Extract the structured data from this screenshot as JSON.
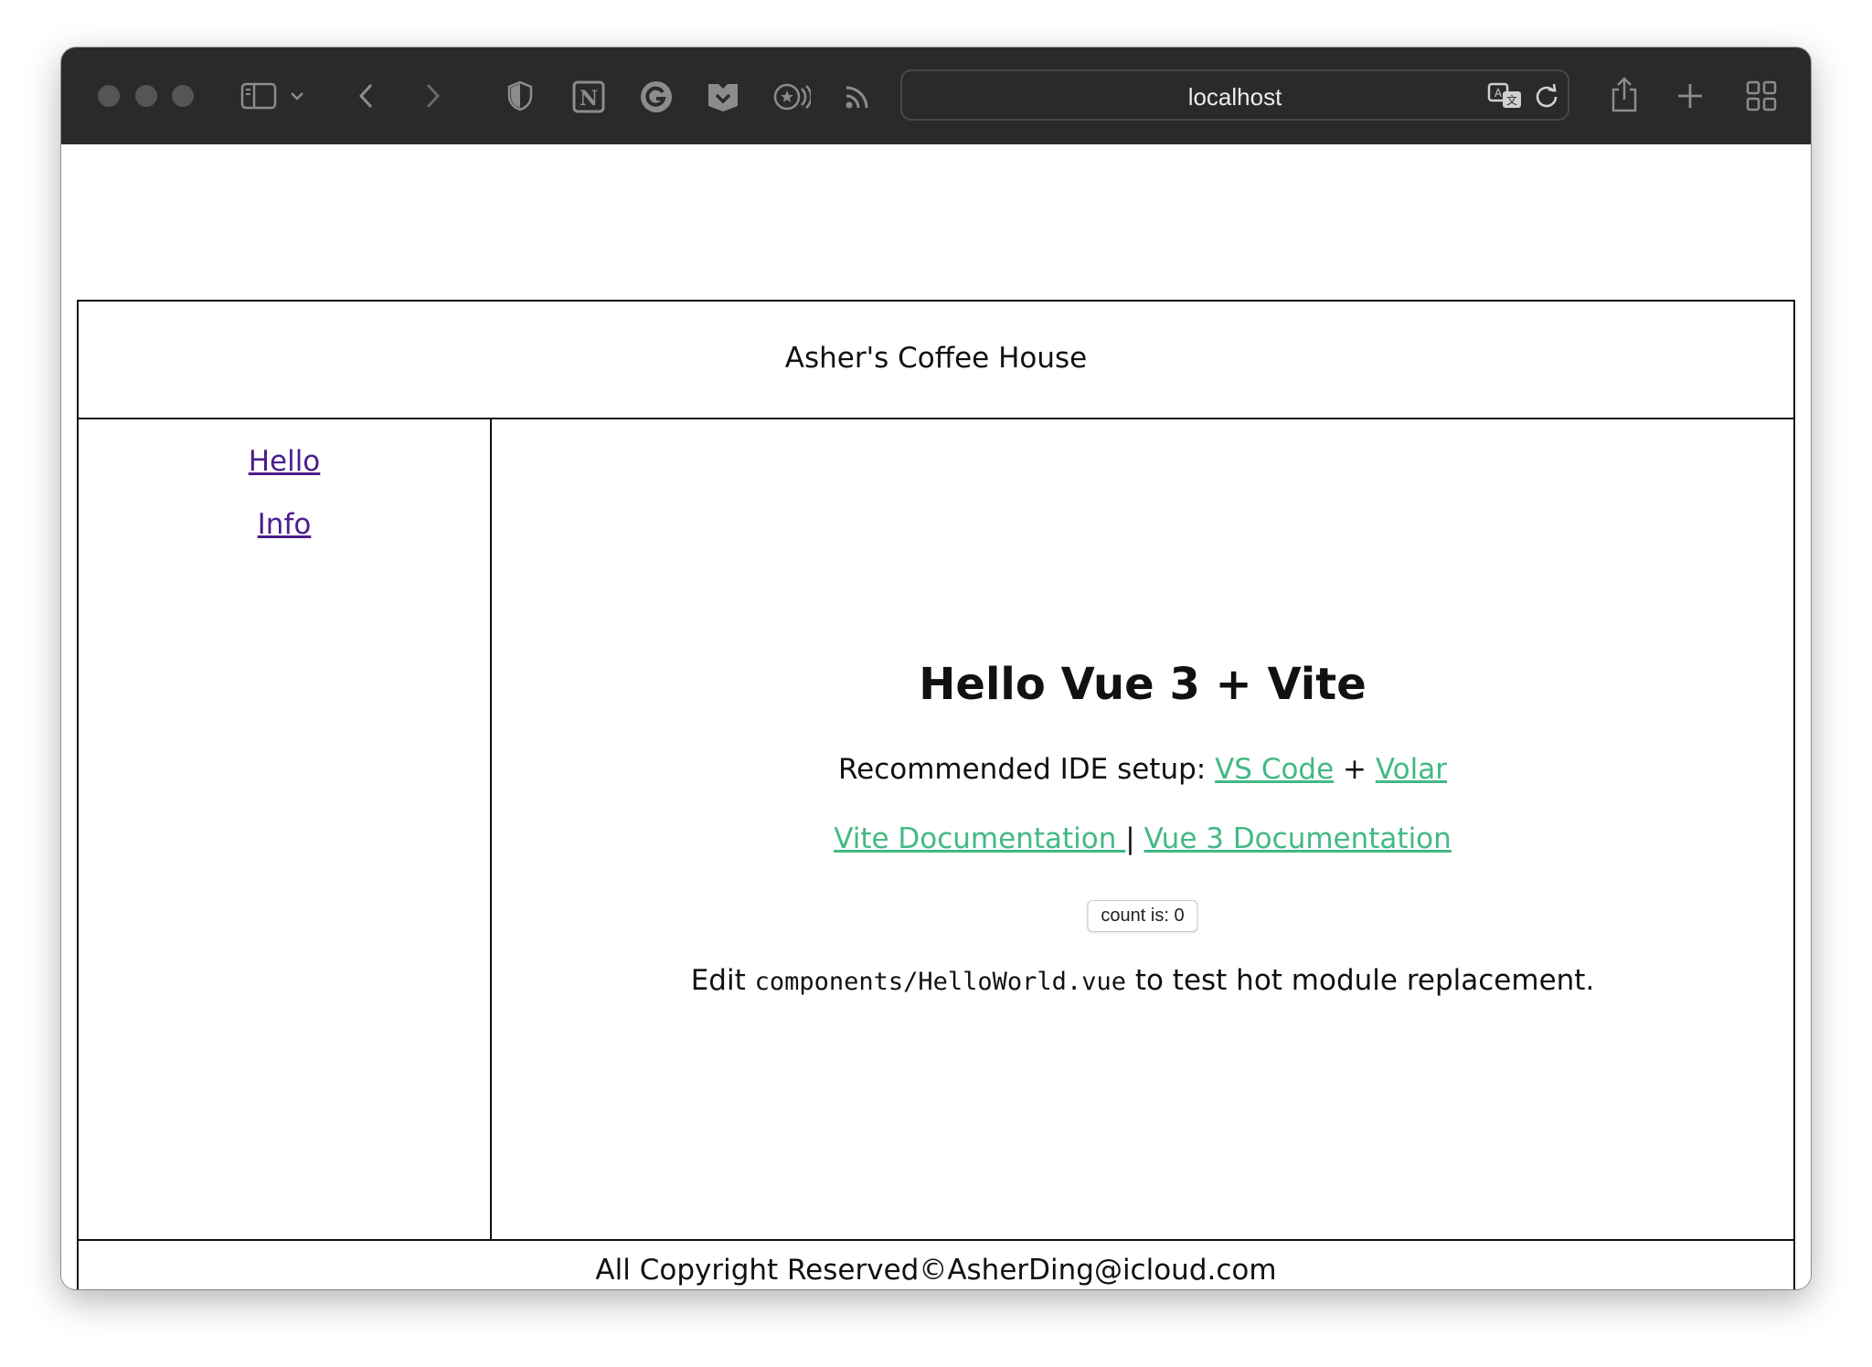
{
  "browser": {
    "address": "localhost"
  },
  "header": {
    "title": "Asher's Coffee House"
  },
  "sidebar": {
    "links": [
      {
        "label": "Hello"
      },
      {
        "label": "Info"
      }
    ]
  },
  "main": {
    "heading": "Hello Vue 3 + Vite",
    "ide_prefix": "Recommended IDE setup: ",
    "ide_link_1": "VS Code",
    "ide_plus": " + ",
    "ide_link_2": "Volar",
    "docs_link_1": "Vite Documentation ",
    "docs_separator": "|",
    "docs_link_2": "Vue 3 Documentation",
    "count_button": "count is: 0",
    "edit_prefix": "Edit ",
    "edit_code": "components/HelloWorld.vue",
    "edit_suffix": " to test hot module replacement."
  },
  "footer": {
    "text": "All Copyright Reserved©AsherDing@icloud.com"
  },
  "colors": {
    "toolbar": "#2c2a29",
    "link_visited": "#4b1f8c",
    "vue_green": "#42b983"
  }
}
